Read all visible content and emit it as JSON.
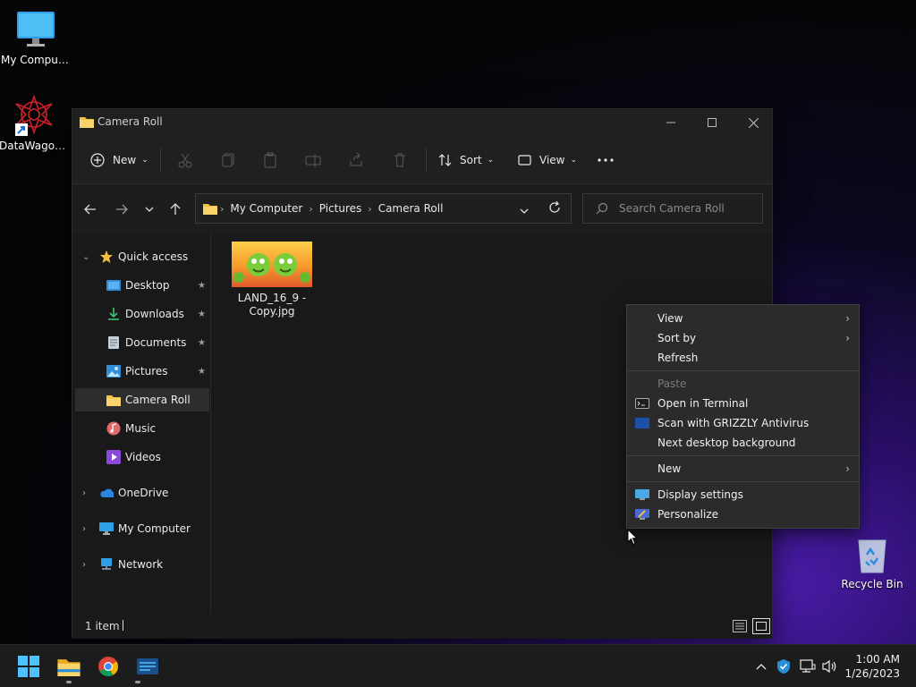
{
  "desktop": {
    "icons": [
      {
        "label": "My Computer"
      },
      {
        "label": "DataWagon..."
      },
      {
        "label": "Recycle Bin"
      }
    ]
  },
  "window": {
    "title": "Camera Roll",
    "toolbar": {
      "new_label": "New",
      "sort_label": "Sort",
      "view_label": "View"
    },
    "address": {
      "crumbs": [
        "My Computer",
        "Pictures",
        "Camera Roll"
      ]
    },
    "search": {
      "placeholder": "Search Camera Roll"
    },
    "sidebar": {
      "quick_access": "Quick access",
      "items": [
        {
          "label": "Desktop",
          "pinned": true
        },
        {
          "label": "Downloads",
          "pinned": true
        },
        {
          "label": "Documents",
          "pinned": true
        },
        {
          "label": "Pictures",
          "pinned": true
        },
        {
          "label": "Camera Roll",
          "selected": true
        },
        {
          "label": "Music"
        },
        {
          "label": "Videos"
        }
      ],
      "roots": [
        {
          "label": "OneDrive"
        },
        {
          "label": "My Computer"
        },
        {
          "label": "Network"
        }
      ]
    },
    "files": [
      {
        "name": "LAND_16_9 - Copy.jpg"
      }
    ],
    "status": {
      "count": "1 item"
    }
  },
  "context_menu": {
    "items": [
      {
        "label": "View",
        "submenu": true
      },
      {
        "label": "Sort by",
        "submenu": true
      },
      {
        "label": "Refresh"
      },
      {
        "label": "Paste",
        "disabled": true
      },
      {
        "label": "Open in Terminal",
        "icon": "terminal-icon"
      },
      {
        "label": "Scan with GRIZZLY Antivirus",
        "icon": "shield-scan-icon"
      },
      {
        "label": "Next desktop background"
      },
      {
        "label": "New",
        "submenu": true
      },
      {
        "label": "Display settings",
        "icon": "display-icon"
      },
      {
        "label": "Personalize",
        "icon": "personalize-icon"
      }
    ]
  },
  "taskbar": {
    "clock": {
      "time": "1:00 AM",
      "date": "1/26/2023"
    }
  },
  "colors": {
    "accent": "#4cc2ff",
    "folder": "#f3c040",
    "window_bg": "#191919",
    "menu_bg": "#2b2b2b"
  }
}
